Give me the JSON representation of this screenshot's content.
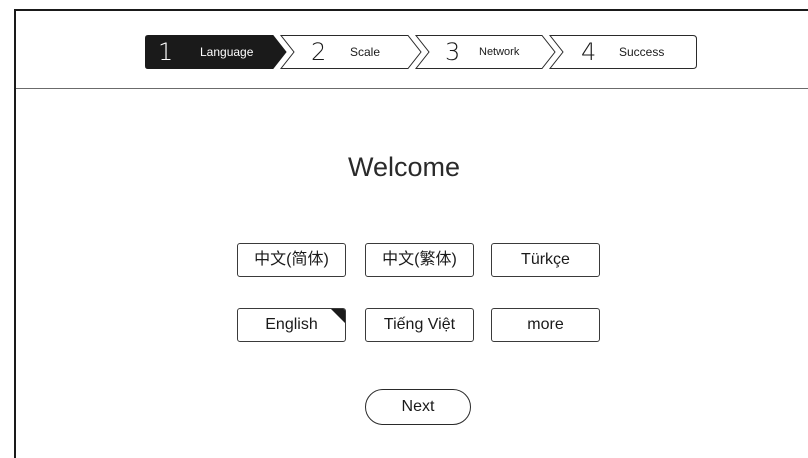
{
  "stepper": {
    "steps": [
      {
        "number": "1",
        "label": "Language",
        "active": true
      },
      {
        "number": "2",
        "label": "Scale",
        "active": false
      },
      {
        "number": "3",
        "label": "Network",
        "active": false
      },
      {
        "number": "4",
        "label": "Success",
        "active": false
      }
    ]
  },
  "main": {
    "title": "Welcome",
    "languages": [
      {
        "label": "中文(简体)",
        "selected": false
      },
      {
        "label": "中文(繁体)",
        "selected": false
      },
      {
        "label": "Türkçe",
        "selected": false
      },
      {
        "label": "English",
        "selected": true
      },
      {
        "label": "Tiếng Việt",
        "selected": false
      },
      {
        "label": "more",
        "selected": false
      }
    ],
    "next_label": "Next"
  },
  "colors": {
    "active_step_bg": "#1a1a1a",
    "border": "#2a2a2a",
    "background": "#ffffff"
  }
}
